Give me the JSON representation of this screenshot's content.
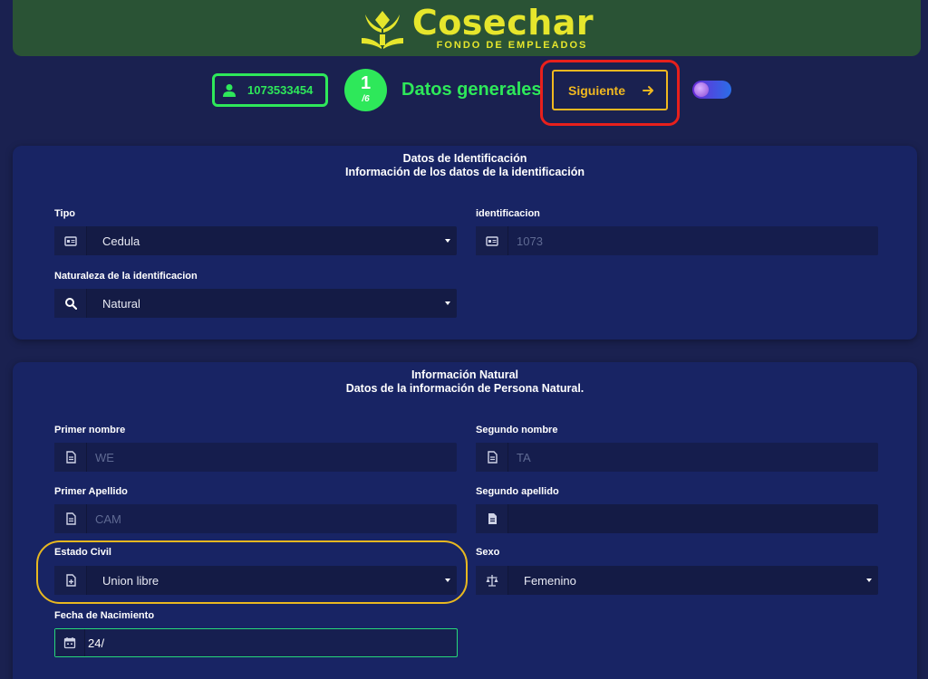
{
  "brand": {
    "name": "Cosechar",
    "subtitle": "FONDO DE EMPLEADOS"
  },
  "header": {
    "user_id": "1073533454",
    "step_current": "1",
    "step_total": "/6",
    "section_title": "Datos generales",
    "next_label": "Siguiente",
    "next_icon": "arrow-right-icon"
  },
  "identificacion": {
    "title": "Datos de Identificación",
    "subtitle": "Información de los datos de la identificación",
    "tipo": {
      "label": "Tipo",
      "value": "Cedula",
      "icon": "id-card-icon"
    },
    "numero": {
      "label": "identificacion",
      "value": "1073",
      "icon": "id-card-icon"
    },
    "naturaleza": {
      "label": "Naturaleza de la identificacion",
      "value": "Natural",
      "icon": "search-icon"
    }
  },
  "natural": {
    "title": "Información Natural",
    "subtitle": "Datos de la información de Persona Natural.",
    "primer_nombre": {
      "label": "Primer nombre",
      "value": "WE"
    },
    "segundo_nombre": {
      "label": "Segundo nombre",
      "value": "TA"
    },
    "primer_apellido": {
      "label": "Primer Apellido",
      "value": "CAM"
    },
    "segundo_apellido": {
      "label": "Segundo apellido",
      "value": ""
    },
    "estado_civil": {
      "label": "Estado Civil",
      "value": "Union libre"
    },
    "sexo": {
      "label": "Sexo",
      "value": "Femenino",
      "icon": "balance-scale-icon"
    },
    "fecha_nacimiento": {
      "label": "Fecha de Nacimiento",
      "value": "24/",
      "icon": "calendar-icon"
    }
  },
  "colors": {
    "background": "#1a2150",
    "card": "#182464",
    "brand_bar": "#2a5335",
    "accent_green": "#2ee85a",
    "accent_yellow": "#f0b820",
    "brand_yellow": "#e6e62c",
    "annotation_red": "#e8201c"
  }
}
